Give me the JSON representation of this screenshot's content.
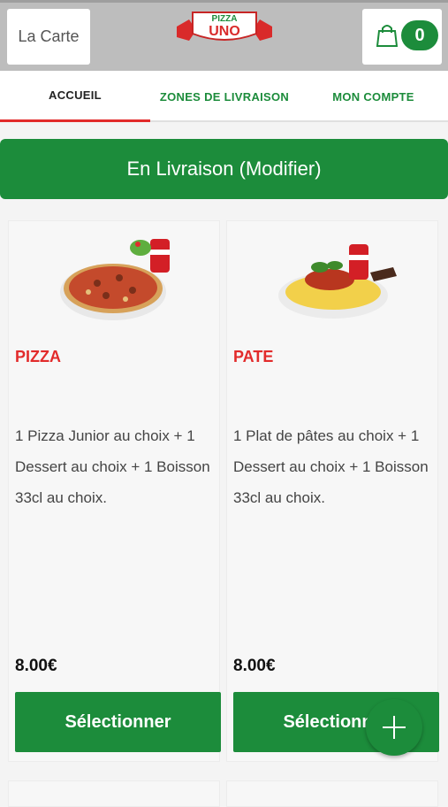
{
  "header": {
    "menu_label": "La Carte",
    "logo_text_top": "PIZZA",
    "logo_text_bottom": "UNO",
    "cart_count": "0"
  },
  "tabs": [
    {
      "label": "ACCUEIL",
      "active": true
    },
    {
      "label": "ZONES DE LIVRAISON",
      "active": false
    },
    {
      "label": "MON COMPTE",
      "active": false
    }
  ],
  "delivery_banner": "En Livraison (Modifier)",
  "products": [
    {
      "title": "PIZZA",
      "description": "1 Pizza Junior au choix + 1 Dessert au choix + 1 Boisson 33cl au choix.",
      "price": "8.00€",
      "button": "Sélectionner"
    },
    {
      "title": "PATE",
      "description": "1 Plat de pâtes au choix + 1 Dessert au choix + 1 Boisson 33cl au choix.",
      "price": "8.00€",
      "button": "Sélectionner"
    }
  ],
  "colors": {
    "accent_green": "#1c8c3b",
    "accent_red": "#e22b2b",
    "topbar_gray": "#bdbdbd"
  }
}
